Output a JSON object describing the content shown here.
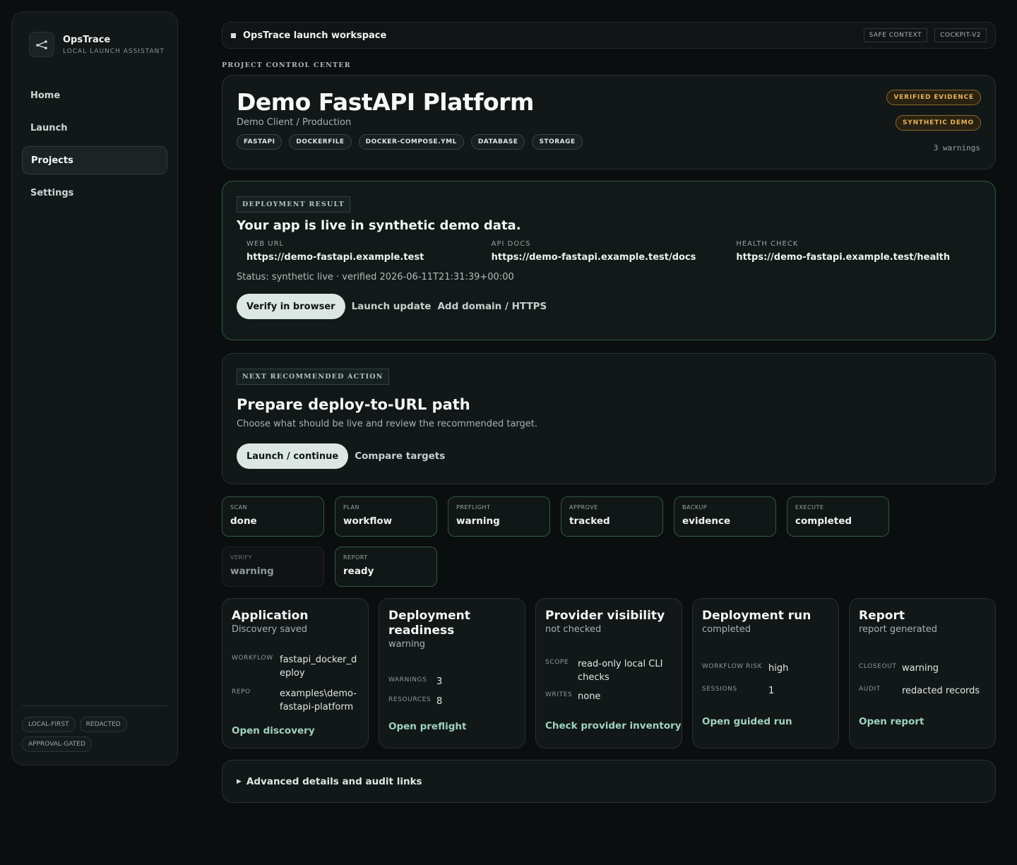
{
  "brand": {
    "name": "OpsTrace",
    "subtitle": "LOCAL LAUNCH ASSISTANT",
    "icon": "share-branch-icon"
  },
  "nav": {
    "items": [
      {
        "label": "Home"
      },
      {
        "label": "Launch"
      },
      {
        "label": "Projects",
        "active": true
      },
      {
        "label": "Settings"
      }
    ]
  },
  "sidebar_tags": [
    "LOCAL-FIRST",
    "REDACTED",
    "APPROVAL-GATED"
  ],
  "topbar": {
    "title": "OpsTrace launch workspace",
    "chips": [
      "SAFE CONTEXT",
      "COCKPIT-V2"
    ]
  },
  "section_label": "PROJECT CONTROL CENTER",
  "project": {
    "title": "Demo FastAPI Platform",
    "subtitle": "Demo Client / Production",
    "tags": [
      "FASTAPI",
      "DOCKERFILE",
      "DOCKER-COMPOSE.YML",
      "DATABASE",
      "STORAGE"
    ],
    "badges": [
      "VERIFIED EVIDENCE",
      "SYNTHETIC DEMO"
    ],
    "warnings": "3 warnings"
  },
  "deployment": {
    "label": "DEPLOYMENT RESULT",
    "title": "Your app is live in synthetic demo data.",
    "urls": [
      {
        "label": "WEB URL",
        "value": "https://demo-fastapi.example.test"
      },
      {
        "label": "API DOCS",
        "value": "https://demo-fastapi.example.test/docs"
      },
      {
        "label": "HEALTH CHECK",
        "value": "https://demo-fastapi.example.test/health"
      }
    ],
    "status": "Status: synthetic live · verified 2026-06-11T21:31:39+00:00",
    "primary_button": "Verify in browser",
    "links": [
      "Launch update",
      "Add domain / HTTPS"
    ]
  },
  "next_action": {
    "label": "NEXT RECOMMENDED ACTION",
    "title": "Prepare deploy-to-URL path",
    "subtitle": "Choose what should be live and review the recommended target.",
    "primary_button": "Launch / continue",
    "link": "Compare targets"
  },
  "steps": [
    {
      "label": "SCAN",
      "value": "done"
    },
    {
      "label": "PLAN",
      "value": "workflow"
    },
    {
      "label": "PREFLIGHT",
      "value": "warning"
    },
    {
      "label": "APPROVE",
      "value": "tracked"
    },
    {
      "label": "BACKUP",
      "value": "evidence"
    },
    {
      "label": "EXECUTE",
      "value": "completed"
    },
    {
      "label": "VERIFY",
      "value": "warning"
    },
    {
      "label": "REPORT",
      "value": "ready"
    }
  ],
  "panels": [
    {
      "title": "Application",
      "status": "Discovery saved",
      "kv": [
        {
          "k": "WORKFLOW",
          "v": "fastapi_docker_deploy"
        },
        {
          "k": "REPO",
          "v": "examples\\demo-fastapi-platform"
        }
      ],
      "link": "Open discovery"
    },
    {
      "title": "Deployment readiness",
      "status": "warning",
      "kv": [
        {
          "k": "WARNINGS",
          "v": "3"
        },
        {
          "k": "RESOURCES",
          "v": "8"
        }
      ],
      "link": "Open preflight"
    },
    {
      "title": "Provider visibility",
      "status": "not checked",
      "kv": [
        {
          "k": "SCOPE",
          "v": "read-only local CLI checks"
        },
        {
          "k": "WRITES",
          "v": "none"
        }
      ],
      "link": "Check provider inventory"
    },
    {
      "title": "Deployment run",
      "status": "completed",
      "kv": [
        {
          "k": "WORKFLOW RISK",
          "v": "high"
        },
        {
          "k": "SESSIONS",
          "v": "1"
        }
      ],
      "link": "Open guided run"
    },
    {
      "title": "Report",
      "status": "report generated",
      "kv": [
        {
          "k": "CLOSEOUT",
          "v": "warning"
        },
        {
          "k": "AUDIT",
          "v": "redacted records"
        }
      ],
      "link": "Open report"
    }
  ],
  "advanced": {
    "label": "Advanced details and audit links"
  }
}
